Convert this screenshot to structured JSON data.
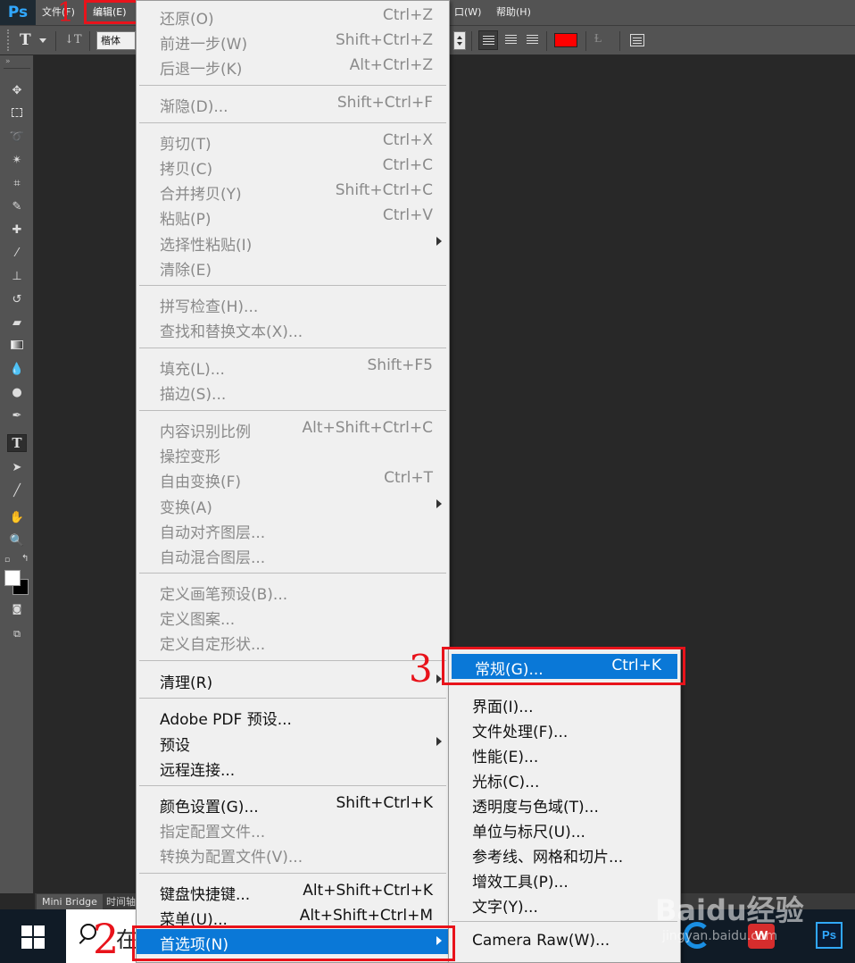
{
  "app": {
    "logo": "Ps",
    "accent": "#31a8ff"
  },
  "menubar": {
    "file": "文件(F)",
    "edit": "编辑(E)",
    "window_partial": "口(W)",
    "help": "帮助(H)"
  },
  "options_bar": {
    "font_name": "楷体",
    "text_color": "#ff0000"
  },
  "edit_menu": {
    "items": [
      {
        "label": "还原(O)",
        "shortcut": "Ctrl+Z",
        "enabled": false
      },
      {
        "label": "前进一步(W)",
        "shortcut": "Shift+Ctrl+Z",
        "enabled": false
      },
      {
        "label": "后退一步(K)",
        "shortcut": "Alt+Ctrl+Z",
        "enabled": false
      },
      {
        "label": "渐隐(D)...",
        "shortcut": "Shift+Ctrl+F",
        "enabled": false
      },
      {
        "label": "剪切(T)",
        "shortcut": "Ctrl+X",
        "enabled": false
      },
      {
        "label": "拷贝(C)",
        "shortcut": "Ctrl+C",
        "enabled": false
      },
      {
        "label": "合并拷贝(Y)",
        "shortcut": "Shift+Ctrl+C",
        "enabled": false
      },
      {
        "label": "粘贴(P)",
        "shortcut": "Ctrl+V",
        "enabled": false
      },
      {
        "label": "选择性粘贴(I)",
        "shortcut": "",
        "enabled": false
      },
      {
        "label": "清除(E)",
        "shortcut": "",
        "enabled": false
      },
      {
        "label": "拼写检查(H)...",
        "shortcut": "",
        "enabled": false
      },
      {
        "label": "查找和替换文本(X)...",
        "shortcut": "",
        "enabled": false
      },
      {
        "label": "填充(L)...",
        "shortcut": "Shift+F5",
        "enabled": false
      },
      {
        "label": "描边(S)...",
        "shortcut": "",
        "enabled": false
      },
      {
        "label": "内容识别比例",
        "shortcut": "Alt+Shift+Ctrl+C",
        "enabled": false
      },
      {
        "label": "操控变形",
        "shortcut": "",
        "enabled": false
      },
      {
        "label": "自由变换(F)",
        "shortcut": "Ctrl+T",
        "enabled": false
      },
      {
        "label": "变换(A)",
        "shortcut": "",
        "enabled": false
      },
      {
        "label": "自动对齐图层...",
        "shortcut": "",
        "enabled": false
      },
      {
        "label": "自动混合图层...",
        "shortcut": "",
        "enabled": false
      },
      {
        "label": "定义画笔预设(B)...",
        "shortcut": "",
        "enabled": false
      },
      {
        "label": "定义图案...",
        "shortcut": "",
        "enabled": false
      },
      {
        "label": "定义自定形状...",
        "shortcut": "",
        "enabled": false
      },
      {
        "label": "清理(R)",
        "shortcut": "",
        "enabled": true
      },
      {
        "label": "Adobe PDF 预设...",
        "shortcut": "",
        "enabled": true
      },
      {
        "label": "预设",
        "shortcut": "",
        "enabled": true
      },
      {
        "label": "远程连接...",
        "shortcut": "",
        "enabled": true
      },
      {
        "label": "颜色设置(G)...",
        "shortcut": "Shift+Ctrl+K",
        "enabled": true
      },
      {
        "label": "指定配置文件...",
        "shortcut": "",
        "enabled": false
      },
      {
        "label": "转换为配置文件(V)...",
        "shortcut": "",
        "enabled": false
      },
      {
        "label": "键盘快捷键...",
        "shortcut": "Alt+Shift+Ctrl+K",
        "enabled": true
      },
      {
        "label": "菜单(U)...",
        "shortcut": "Alt+Shift+Ctrl+M",
        "enabled": true
      },
      {
        "label": "首选项(N)",
        "shortcut": "",
        "enabled": true
      }
    ]
  },
  "prefs_submenu": {
    "items": [
      {
        "label": "常规(G)...",
        "shortcut": "Ctrl+K"
      },
      {
        "label": "界面(I)..."
      },
      {
        "label": "文件处理(F)..."
      },
      {
        "label": "性能(E)..."
      },
      {
        "label": "光标(C)..."
      },
      {
        "label": "透明度与色域(T)..."
      },
      {
        "label": "单位与标尺(U)..."
      },
      {
        "label": "参考线、网格和切片..."
      },
      {
        "label": "增效工具(P)..."
      },
      {
        "label": "文字(Y)..."
      },
      {
        "label": "Camera Raw(W)..."
      }
    ]
  },
  "annotations": {
    "step1": "1",
    "step2": "2",
    "step3": "3",
    "highlight_color": "#e8131b"
  },
  "bottom_panel": {
    "tab_minibridge": "Mini Bridge",
    "tab_timeline_partial": "时间轴"
  },
  "taskbar": {
    "search_partial": "在"
  },
  "watermark": {
    "brand": "Baidu经验",
    "url": "jingyan.baidu.com"
  }
}
